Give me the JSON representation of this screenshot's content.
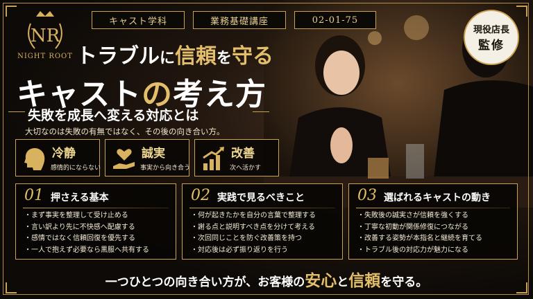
{
  "brand": {
    "monogram": "NR",
    "name": "NIGHT ROOT"
  },
  "chips": [
    "キャスト学科",
    "業務基礎講座",
    "02-01-75"
  ],
  "badge": {
    "line1": "現役店長",
    "line2": "監修"
  },
  "title": {
    "line1_a": "トラブル",
    "line1_b": "に",
    "line1_c": "信頼",
    "line1_d": "を",
    "line1_e": "守る",
    "line2_a": "キャスト",
    "line2_b": "の",
    "line2_c": "考え方"
  },
  "subtitle": "失敗を成長へ変える対応とは",
  "lead": "大切なのは失敗の有無ではなく、その後の向き合い方。",
  "keywords": [
    {
      "title": "冷静",
      "sub": "感情的にならない",
      "icon": "head-icon"
    },
    {
      "title": "誠実",
      "sub": "事実から向き合う",
      "icon": "heart-hand-icon"
    },
    {
      "title": "改善",
      "sub": "次へ活かす",
      "icon": "growth-chart-icon"
    }
  ],
  "cards": [
    {
      "num": "01",
      "title": "押さえる基本",
      "items": [
        "まず事実を整理して受け止める",
        "言い訳より先に不快感へ配慮する",
        "感情ではなく信頼回復を優先する",
        "一人で抱えず必要なら黒服へ共有する"
      ]
    },
    {
      "num": "02",
      "title": "実践で見るべきこと",
      "items": [
        "何が起きたかを自分の言葉で整理する",
        "謝る点と説明すべき点を分けて考える",
        "次回同じことを防ぐ改善策を持つ",
        "対応後は必ず振り返りを行う"
      ]
    },
    {
      "num": "03",
      "title": "選ばれるキャストの動き",
      "items": [
        "失敗後の誠実さが信頼を強くする",
        "丁寧な初動が関係修復につながる",
        "改善する姿勢が本指名と継続を育てる",
        "トラブル後の対応力が魅力になる"
      ]
    }
  ],
  "bottom": {
    "a": "一つひとつの向き合い方が、お客様の",
    "b": "安心",
    "c": "と",
    "d": "信頼",
    "e": "を守る。"
  },
  "colors": {
    "gold": "#c9a352",
    "gold_light": "#e3bf6c",
    "background": "#0b0906"
  }
}
